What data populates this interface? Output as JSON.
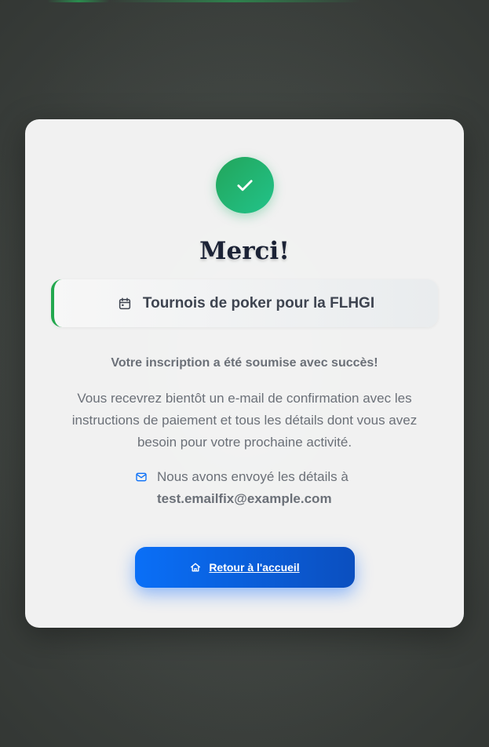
{
  "confirmation": {
    "title": "Merci!",
    "event_name": "Tournois de poker pour la FLHGI",
    "status_message": "Votre inscription a été soumise avec succès!",
    "description": "Vous recevrez bientôt un e-mail de confirmation avec les instructions de paiement et tous les détails dont vous avez besoin pour votre prochaine activité.",
    "email_intro": "Nous avons envoyé les détails à",
    "email_address": "test.emailfix@example.com",
    "home_button_label": "Retour à l'accueil"
  },
  "icons": {
    "success": "check-icon",
    "event": "calendar-icon",
    "email": "mail-icon",
    "home": "home-icon"
  },
  "colors": {
    "success_green": "#22a55a",
    "accent_border": "#23a84e",
    "button_blue": "#0a6ff7",
    "title_dark": "#1b2235",
    "muted_text": "#6b7078"
  }
}
